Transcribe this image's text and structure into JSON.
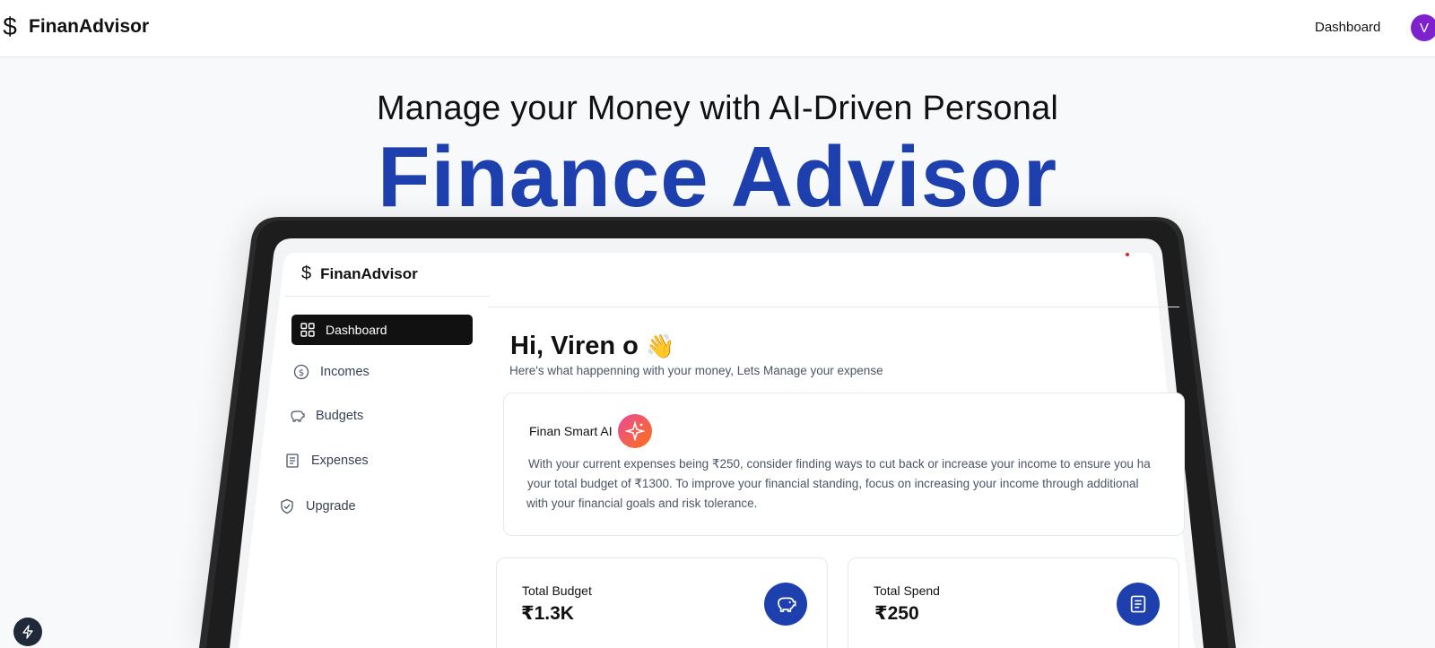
{
  "topnav": {
    "brand_icon": "$",
    "brand": "FinanAdvisor",
    "dashboard_link": "Dashboard",
    "avatar_initial": "V",
    "avatar_color": "#7e22ce"
  },
  "hero": {
    "line1": "Manage your Money with AI-Driven Personal",
    "line2": "Finance Advisor",
    "accent_color": "#1e40af"
  },
  "preview": {
    "brand_icon": "$",
    "brand": "FinanAdvisor",
    "sidebar": {
      "items": [
        {
          "label": "Dashboard",
          "icon": "layout-grid-icon",
          "active": true
        },
        {
          "label": "Incomes",
          "icon": "circle-dollar-icon",
          "active": false
        },
        {
          "label": "Budgets",
          "icon": "piggy-bank-icon",
          "active": false
        },
        {
          "label": "Expenses",
          "icon": "receipt-icon",
          "active": false
        },
        {
          "label": "Upgrade",
          "icon": "shield-check-icon",
          "active": false
        }
      ]
    },
    "greeting": "Hi, Viren o",
    "greeting_emoji": "👋",
    "subtitle": "Here's what happenning with your money, Lets Manage your expense",
    "ai_card": {
      "title": "Finan Smart AI",
      "icon": "sparkles-icon",
      "lines": [
        "With your current expenses being ₹250, consider finding ways to cut back or increase your income to ensure you ha",
        "your total budget of ₹1300. To improve your financial standing, focus on increasing your income through additional",
        "with your financial goals and risk tolerance."
      ]
    },
    "stats": [
      {
        "label": "Total Budget",
        "value": "₹1.3K",
        "icon": "piggy-bank-icon"
      },
      {
        "label": "Total Spend",
        "value": "₹250",
        "icon": "receipt-icon"
      }
    ]
  },
  "floating_badge": {
    "icon": "bolt-icon"
  }
}
